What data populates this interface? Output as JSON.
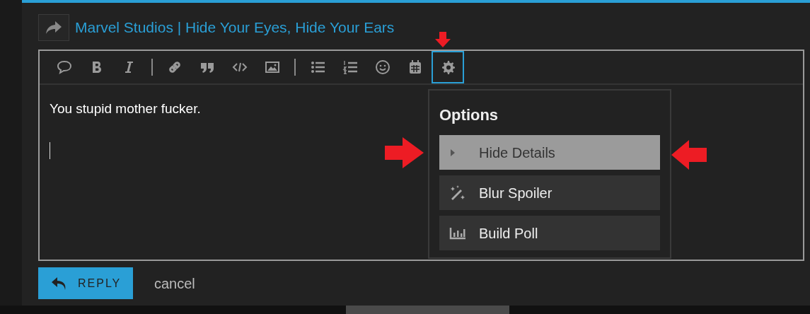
{
  "thread_link": {
    "title": "Marvel Studios | Hide Your Eyes, Hide Your Ears"
  },
  "toolbar": [
    {
      "kind": "speech",
      "selected": false
    },
    {
      "kind": "bold",
      "selected": false
    },
    {
      "kind": "italic",
      "selected": false
    },
    {
      "kind": "separator"
    },
    {
      "kind": "link",
      "selected": false
    },
    {
      "kind": "quote",
      "selected": false
    },
    {
      "kind": "code",
      "selected": false
    },
    {
      "kind": "image",
      "selected": false
    },
    {
      "kind": "separator"
    },
    {
      "kind": "bullets",
      "selected": false
    },
    {
      "kind": "numbers",
      "selected": false
    },
    {
      "kind": "smiley",
      "selected": false
    },
    {
      "kind": "calendar",
      "selected": false
    },
    {
      "kind": "gear",
      "selected": true
    }
  ],
  "editor": {
    "value": "You stupid mother fucker."
  },
  "options_menu": {
    "title": "Options",
    "items": [
      {
        "kind": "caret",
        "label": "Hide Details",
        "selected": true
      },
      {
        "kind": "wand",
        "label": "Blur Spoiler",
        "selected": false
      },
      {
        "kind": "poll",
        "label": "Build Poll",
        "selected": false
      }
    ]
  },
  "buttons": {
    "reply": "REPLY",
    "cancel": "cancel"
  }
}
